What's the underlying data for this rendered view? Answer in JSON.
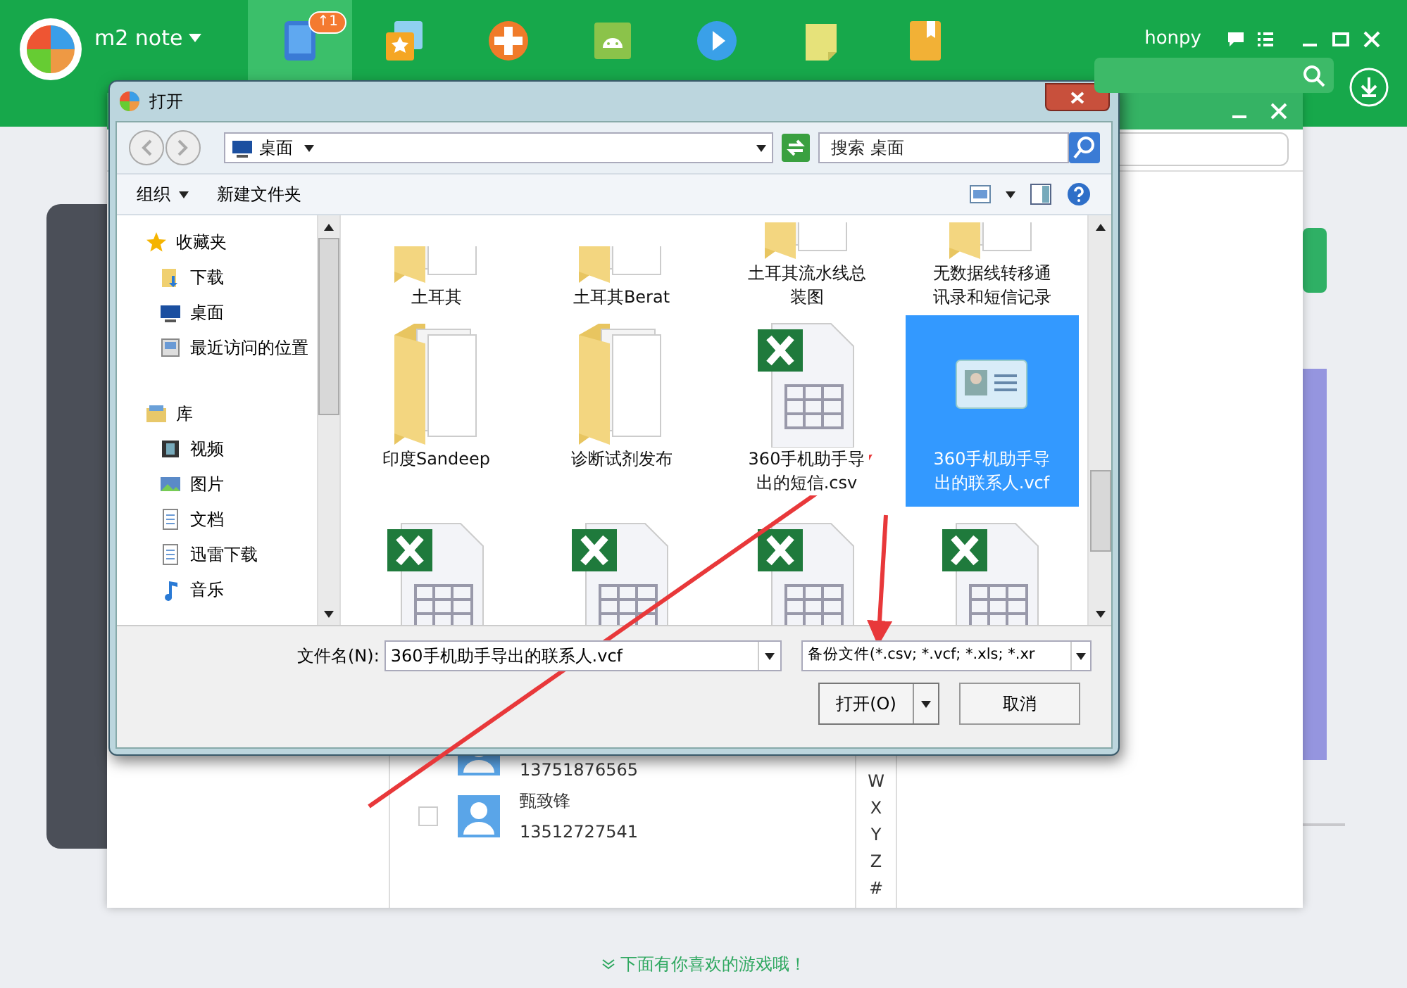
{
  "app": {
    "device": "m2 note",
    "toolbar": [
      {
        "kind": "phone",
        "badge": "↑1",
        "selected": true
      },
      {
        "kind": "star",
        "selected": false
      },
      {
        "kind": "game",
        "selected": false
      },
      {
        "kind": "android",
        "selected": false
      },
      {
        "kind": "play",
        "selected": false
      },
      {
        "kind": "note",
        "selected": false
      },
      {
        "kind": "book",
        "selected": false
      }
    ],
    "user": "honpy"
  },
  "contacts_window": {
    "contacts": [
      {
        "phone": "13751876565"
      },
      {
        "name": "甄致锋",
        "phone": "13512727541",
        "checked": false
      }
    ],
    "index": [
      "W",
      "X",
      "Y",
      "Z",
      "#"
    ],
    "footer": "下面有你喜欢的游戏哦！"
  },
  "dialog": {
    "title": "打开",
    "location": "桌面",
    "search": {
      "placeholder": "搜索 桌面"
    },
    "toolbar": [
      {
        "label": "组织",
        "kind": "menu"
      },
      {
        "label": "新建文件夹",
        "kind": "button"
      }
    ],
    "nav": [
      {
        "label": "收藏夹",
        "kind": "star",
        "children": [
          {
            "label": "下载",
            "kind": "download"
          },
          {
            "label": "桌面",
            "kind": "desktop"
          },
          {
            "label": "最近访问的位置",
            "kind": "recent"
          }
        ]
      },
      {
        "label": "库",
        "kind": "library",
        "children": [
          {
            "label": "视频",
            "kind": "video"
          },
          {
            "label": "图片",
            "kind": "picture"
          },
          {
            "label": "文档",
            "kind": "document"
          },
          {
            "label": "迅雷下载",
            "kind": "document"
          },
          {
            "label": "音乐",
            "kind": "music"
          }
        ]
      }
    ],
    "files": [
      {
        "name": "土耳其",
        "kind": "folder",
        "selected": false
      },
      {
        "name": "土耳其Berat",
        "kind": "folder",
        "selected": false
      },
      {
        "name": "土耳其流水线总装图",
        "kind": "folder",
        "selected": false
      },
      {
        "name": "无数据线转移通讯录和短信记录",
        "kind": "folder",
        "selected": false
      },
      {
        "name": "印度Sandeep",
        "kind": "folder",
        "selected": false
      },
      {
        "name": "诊断试剂发布",
        "kind": "folder",
        "selected": false
      },
      {
        "name": "360手机助手导出的短信.csv",
        "kind": "excel",
        "selected": false
      },
      {
        "name": "360手机助手导出的联系人.vcf",
        "kind": "vcard",
        "selected": true
      },
      {
        "kind": "excel",
        "selected": false
      },
      {
        "kind": "excel",
        "selected": false
      },
      {
        "kind": "excel",
        "selected": false
      },
      {
        "kind": "excel",
        "selected": false
      }
    ],
    "filename_label": "文件名(N):",
    "filename": "360手机助手导出的联系人.vcf",
    "filetype": "备份文件(*.csv; *.vcf; *.xls; *.xr",
    "buttons": [
      {
        "label": "打开(O)",
        "kind": "split"
      },
      {
        "label": "取消",
        "kind": "plain"
      }
    ]
  }
}
